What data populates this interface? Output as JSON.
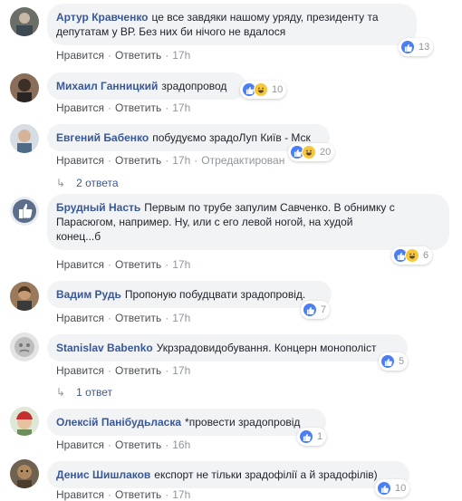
{
  "actions": {
    "like": "Нравится",
    "reply": "Ответить",
    "separator": "·"
  },
  "colors": {
    "author": "#385898",
    "bubble": "#f2f3f5",
    "like": "#4a7ef2",
    "haha": "#f7c73a"
  },
  "comments": [
    {
      "author": "Артур Кравченко",
      "text_line1": "це все завдяки нашому уряду, президенту та",
      "text_line2": "депутатам у ВР. Без них би нічого не вдалося",
      "reactions": [
        "like"
      ],
      "count": "13",
      "time": "17h"
    },
    {
      "author": "Михаил Ганницкий",
      "text": "зрадопровод",
      "reactions": [
        "like",
        "haha"
      ],
      "count": "10",
      "time": "17h"
    },
    {
      "author": "Евгений Бабенко",
      "text": "побудуємо зрадоЛуп Київ - Мск",
      "reactions": [
        "like",
        "haha"
      ],
      "count": "20",
      "time": "17h",
      "edited": "Отредактирован",
      "replies": "2 ответа"
    },
    {
      "author": "Брудный Насть",
      "text_line1": "Первым по трубе запулим Савченко. В обнимку с",
      "text_line2": "Парасюгом, например. Ну, или с его левой ногой, на худой",
      "text_line3": "конец...б",
      "reactions": [
        "like",
        "haha"
      ],
      "count": "6",
      "time": "17h"
    },
    {
      "author": "Вадим Рудь",
      "text": "Пропоную побудцвати зрадопровід.",
      "reactions": [
        "like"
      ],
      "count": "7",
      "time": "17h"
    },
    {
      "author": "Stanislav Babenko",
      "text": "Укрзрадовидобування. Концерн монополіст",
      "reactions": [
        "like"
      ],
      "count": "5",
      "time": "17h",
      "replies": "1 ответ"
    },
    {
      "author": "Олексій Панібудьласка",
      "text": "*провести зрадопровід",
      "reactions": [
        "like"
      ],
      "count": "1",
      "time": "16h"
    },
    {
      "author": "Денис Шишлаков",
      "text": "експорт не тільки зрадофілії а й зрадофілів)",
      "reactions": [
        "like"
      ],
      "count": "10",
      "time": "17h"
    }
  ]
}
